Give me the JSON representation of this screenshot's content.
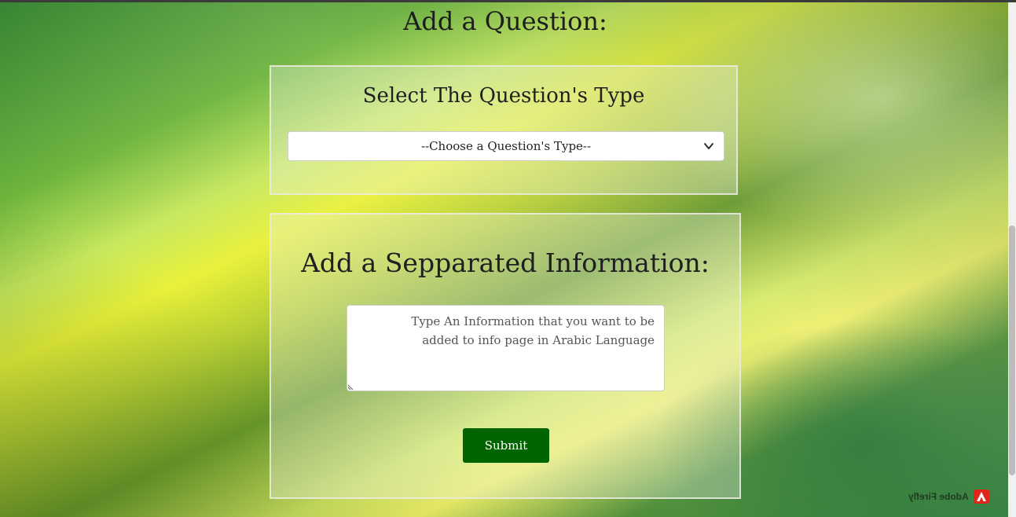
{
  "page": {
    "heading": "Add a Question:"
  },
  "question_type": {
    "title": "Select The Question's Type",
    "select_value": "--Choose a Question's Type--"
  },
  "info_section": {
    "title": "Add a Sepparated Information:",
    "textarea_placeholder": "Type An Information that you want to be added to info page in Arabic Language",
    "submit_label": "Submit"
  },
  "watermark": {
    "text": "Adobe Firefly",
    "logo_color": "#e1251b"
  },
  "colors": {
    "submit_bg": "#006400",
    "panel_border": "#ebebe1"
  }
}
